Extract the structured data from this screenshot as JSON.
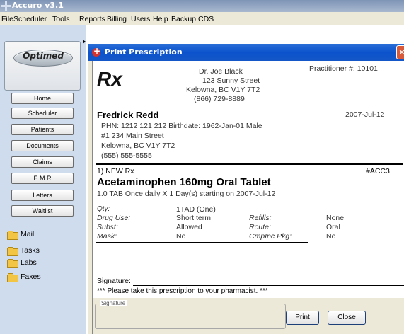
{
  "app": {
    "title": "Accuro v3.1",
    "menu": [
      "File",
      "Scheduler",
      "Tools",
      "Reports",
      "Billing",
      "Users",
      "Help",
      "Backup",
      "CDS"
    ]
  },
  "sidebar": {
    "logo_text": "Optimed",
    "buttons": [
      "Home",
      "Scheduler",
      "Patients",
      "Documents",
      "Claims",
      "E M R",
      "Letters",
      "Waitlist"
    ],
    "folders": [
      "Mail",
      "Tasks",
      "Labs",
      "Faxes"
    ]
  },
  "dialog": {
    "title": "Print Prescription",
    "rx_symbol": "Rx",
    "doctor": {
      "name": "Dr. Joe Black",
      "street": "123 Sunny Street",
      "city": "Kelowna, BC  V1Y 7T2",
      "phone": "(866) 729-8889"
    },
    "practitioner": "Practitioner #: 10101",
    "patient": {
      "name": "Fredrick Redd",
      "phn_line": "PHN: 1212 121 212   Birthdate: 1962-Jan-01 Male",
      "address1": "#1 234 Main Street",
      "address2": "Kelowna, BC  V1Y 7T2",
      "phone": "(555) 555-5555"
    },
    "date": "2007-Jul-12",
    "rx_line": "1) NEW Rx",
    "rx_code": "#ACC3",
    "drug": "Acetaminophen 160mg Oral Tablet",
    "sig": "1.0 TAB Once daily X 1 Day(s) starting on 2007-Jul-12",
    "details": {
      "qty_label": "Qty:",
      "qty_value": "1TAD (One)",
      "druguse_label": "Drug Use:",
      "druguse_value": "Short term",
      "refills_label": "Refills:",
      "refills_value": "None",
      "subst_label": "Subst:",
      "subst_value": "Allowed",
      "route_label": "Route:",
      "route_value": "Oral",
      "mask_label": "Mask:",
      "mask_value": "No",
      "cmpinc_label": "CmpInc Pkg:",
      "cmpinc_value": "No"
    },
    "signature_label": "Signature:",
    "note": "*** Please take this prescription to your pharmacist. ***",
    "signature_box_label": "Signature",
    "print_button": "Print",
    "close_button": "Close"
  }
}
